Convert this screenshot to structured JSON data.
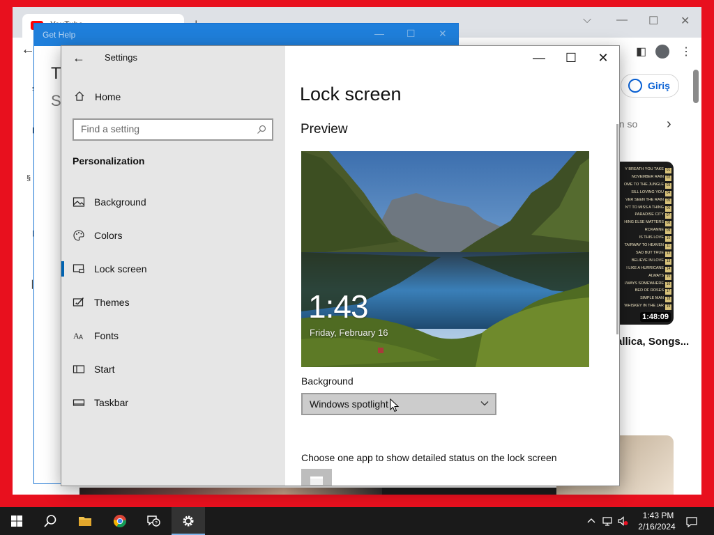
{
  "browser": {
    "tab_title": "YouTube",
    "signin_label": "Giriş",
    "chip_partial": "on so",
    "video_title": "allica, Songs...",
    "tracklist": [
      {
        "title": "Y BREATH YOU TAKE",
        "num": "01"
      },
      {
        "title": "NOVEMBER RAIN",
        "num": "02"
      },
      {
        "title": "OME TO THE JUNGLE",
        "num": "03"
      },
      {
        "title": "SILL LOVING YOU",
        "num": "04"
      },
      {
        "title": "VER SEEN THE RAIN",
        "num": "05"
      },
      {
        "title": "N'T TO MISS A THING",
        "num": "06"
      },
      {
        "title": "PARADISE CITY",
        "num": "07"
      },
      {
        "title": "HING ELSE MATTERS",
        "num": "08"
      },
      {
        "title": "ROXANNE",
        "num": "09"
      },
      {
        "title": "IS THIS LOVE",
        "num": "10"
      },
      {
        "title": "TAIRWAY TO HEAVEN",
        "num": "11"
      },
      {
        "title": "SAD BUT TRUE",
        "num": "12"
      },
      {
        "title": "BELIEVE IN LOVE",
        "num": "13"
      },
      {
        "title": "I LIKE A HURRICANE",
        "num": "14"
      },
      {
        "title": "ALWAYS",
        "num": "15"
      },
      {
        "title": "LWAYS SOMEWHERE",
        "num": "16"
      },
      {
        "title": "BED OF ROSES",
        "num": "17"
      },
      {
        "title": "SIMPLE MAN",
        "num": "18"
      },
      {
        "title": "WHISKEY IN THE JAR",
        "num": "19"
      }
    ],
    "video_duration": "1:48:09"
  },
  "gethelp": {
    "title": "Get Help",
    "partial_heading": "Tr",
    "partial_sub": "So"
  },
  "settings": {
    "window_title": "Settings",
    "home_label": "Home",
    "search_placeholder": "Find a setting",
    "section": "Personalization",
    "nav": [
      {
        "label": "Background",
        "icon": "image-icon"
      },
      {
        "label": "Colors",
        "icon": "palette-icon"
      },
      {
        "label": "Lock screen",
        "icon": "lock-screen-icon"
      },
      {
        "label": "Themes",
        "icon": "themes-icon"
      },
      {
        "label": "Fonts",
        "icon": "fonts-icon"
      },
      {
        "label": "Start",
        "icon": "start-icon"
      },
      {
        "label": "Taskbar",
        "icon": "taskbar-icon"
      }
    ],
    "selected_nav": "Lock screen",
    "page_title": "Lock screen",
    "preview_heading": "Preview",
    "lock_time": "1:43",
    "lock_date": "Friday, February 16",
    "background_label": "Background",
    "background_value": "Windows spotlight",
    "apps_label": "Choose one app to show detailed status on the lock screen"
  },
  "taskbar": {
    "time": "1:43 PM",
    "date": "2/16/2024",
    "accent": "#7eb4ea"
  },
  "colors": {
    "desktop": "#e8101e",
    "settings_accent": "#0063b1",
    "gethelp_titlebar": "#1f7fdb"
  }
}
